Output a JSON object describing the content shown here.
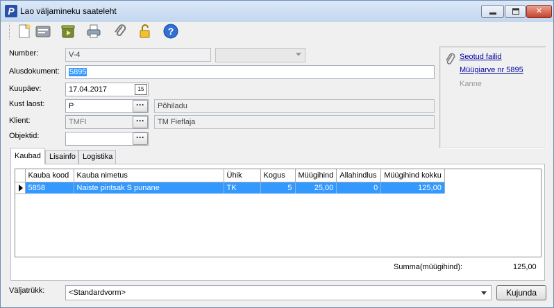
{
  "window": {
    "title": "Lao väljamineku saateleht",
    "app_icon_letter": "P",
    "controls": {
      "minimize": "minimize-icon",
      "maximize": "maximize-icon",
      "close": "✕"
    }
  },
  "toolbar": {
    "buttons": [
      {
        "name": "new-document-icon"
      },
      {
        "name": "form-icon"
      },
      {
        "name": "save-icon"
      },
      {
        "name": "print-icon"
      },
      {
        "name": "attachment-icon"
      },
      {
        "name": "unlock-icon"
      },
      {
        "name": "help-icon",
        "glyph": "?"
      }
    ]
  },
  "form": {
    "number_label": "Number:",
    "number_value": "V-4",
    "alusdokument_label": "Alusdokument:",
    "alusdokument_value": "5895",
    "kuupaev_label": "Kuupäev:",
    "kuupaev_value": "17.04.2017",
    "calendar_glyph": "15",
    "kust_laost_label": "Kust laost:",
    "kust_laost_value": "P",
    "kust_laost_name": "Põhiladu",
    "klient_label": "Klient:",
    "klient_value": "TMFI",
    "klient_name": "TM Fieflaja",
    "objektid_label": "Objektid:",
    "objektid_value": "",
    "lookup_glyph": "···"
  },
  "links": {
    "seotud_failid": "Seotud failid",
    "muugiarve": "Müügiarve nr 5895",
    "kanne": "Kanne"
  },
  "tabs": [
    {
      "label": "Kaubad",
      "active": true
    },
    {
      "label": "Lisainfo",
      "active": false
    },
    {
      "label": "Logistika",
      "active": false
    }
  ],
  "grid": {
    "columns": [
      "Kauba kood",
      "Kauba nimetus",
      "Ühik",
      "Kogus",
      "Müügihind",
      "Allahindlus",
      "Müügihind kokku"
    ],
    "rows": [
      {
        "kood": "5858",
        "nimetus": "Naiste pintsak S punane",
        "uhik": "TK",
        "kogus": "5",
        "muugihind": "25,00",
        "allahindlus": "0",
        "kokku": "125,00"
      }
    ]
  },
  "summary": {
    "label": "Summa(müügihind):",
    "value": "125,00"
  },
  "footer": {
    "valjatrukk_label": "Väljatrükk:",
    "valjatrukk_value": "<Standardvorm>",
    "kujunda_label": "Kujunda"
  }
}
